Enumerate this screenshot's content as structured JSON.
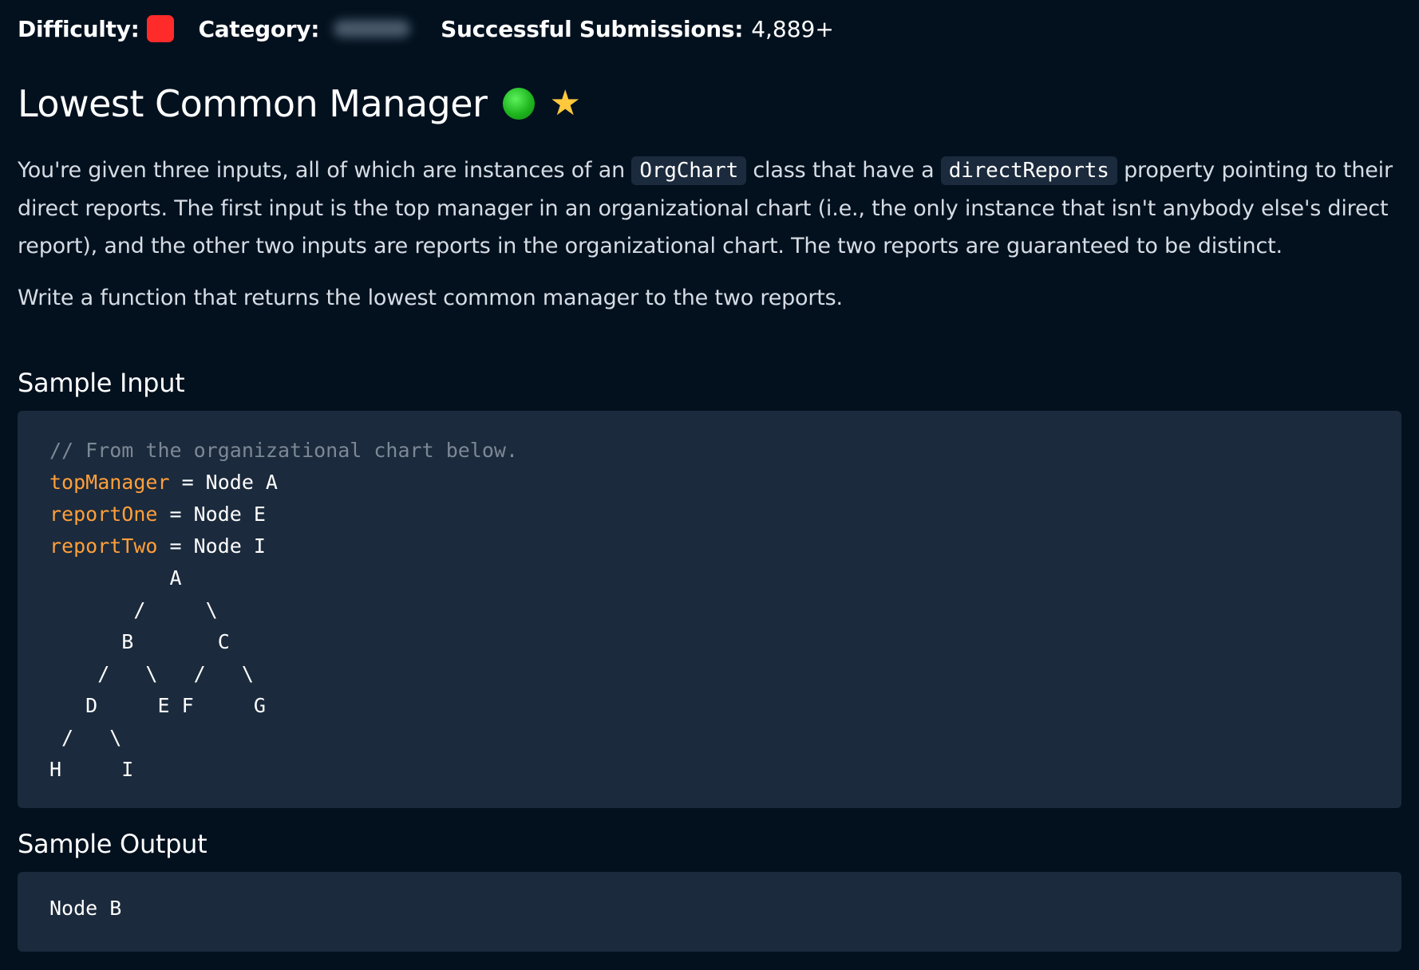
{
  "meta": {
    "difficulty_label": "Difficulty:",
    "difficulty_color": "#ff2b2b",
    "category_label": "Category:",
    "submissions_label": "Successful Submissions:",
    "submissions_value": "4,889+"
  },
  "problem": {
    "title": "Lowest Common Manager",
    "status_color": "#22c022",
    "star_color": "#ffc83d",
    "desc_p1_a": "You're given three inputs, all of which are instances of an ",
    "desc_p1_code1": "OrgChart",
    "desc_p1_b": " class that have a ",
    "desc_p1_code2": "directReports",
    "desc_p1_c": " property pointing to their direct reports. The first input is the top manager in an organizational chart (i.e., the only instance that isn't anybody else's direct report), and the other two inputs are reports in the organizational chart. The two reports are guaranteed to be distinct.",
    "desc_p2": "Write a function that returns the lowest common manager to the two reports."
  },
  "sample_input": {
    "title": "Sample Input",
    "comment": "// From the organizational chart below.",
    "lines": [
      {
        "var": "topManager",
        "rest": " = Node A"
      },
      {
        "var": "reportOne",
        "rest": " = Node E"
      },
      {
        "var": "reportTwo",
        "rest": " = Node I"
      }
    ],
    "tree": [
      "          A",
      "       /     \\",
      "      B       C",
      "    /   \\   /   \\",
      "   D     E F     G",
      " /   \\",
      "H     I"
    ]
  },
  "sample_output": {
    "title": "Sample Output",
    "value": "Node B"
  }
}
